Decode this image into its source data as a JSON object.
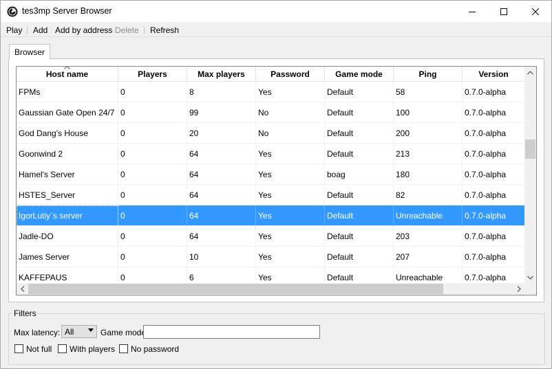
{
  "window": {
    "title": "tes3mp Server Browser"
  },
  "menu": {
    "play": "Play",
    "add": "Add",
    "add_by_address": "Add by address",
    "delete": "Delete",
    "refresh": "Refresh"
  },
  "tabs": [
    {
      "label": "Browser"
    }
  ],
  "table": {
    "columns": [
      "Host name",
      "Players",
      "Max players",
      "Password",
      "Game mode",
      "Ping",
      "Version"
    ],
    "rows": [
      [
        "FPMs",
        "0",
        "8",
        "Yes",
        "Default",
        "58",
        "0.7.0-alpha"
      ],
      [
        "Gaussian Gate Open 24/7",
        "0",
        "99",
        "No",
        "Default",
        "100",
        "0.7.0-alpha"
      ],
      [
        "God Dang's House",
        "0",
        "20",
        "No",
        "Default",
        "200",
        "0.7.0-alpha"
      ],
      [
        "Goonwind 2",
        "0",
        "64",
        "Yes",
        "Default",
        "213",
        "0.7.0-alpha"
      ],
      [
        "Hamel's Server",
        "0",
        "64",
        "Yes",
        "boag",
        "180",
        "0.7.0-alpha"
      ],
      [
        "HSTES_Server",
        "0",
        "64",
        "Yes",
        "Default",
        "82",
        "0.7.0-alpha"
      ],
      [
        "IgorLutiy`s server",
        "0",
        "64",
        "Yes",
        "Default",
        "Unreachable",
        "0.7.0-alpha"
      ],
      [
        "Jadle-DO",
        "0",
        "64",
        "Yes",
        "Default",
        "203",
        "0.7.0-alpha"
      ],
      [
        "James Server",
        "0",
        "10",
        "Yes",
        "Default",
        "207",
        "0.7.0-alpha"
      ],
      [
        "KAFFEPAUS",
        "0",
        "6",
        "Yes",
        "Default",
        "Unreachable",
        "0.7.0-alpha"
      ]
    ],
    "selected_row": 6
  },
  "filters": {
    "title": "Filters",
    "max_latency_label": "Max latency:",
    "max_latency_value": "All",
    "game_mode_label": "Game mode",
    "game_mode_value": "",
    "not_full_label": "Not full",
    "with_players_label": "With players",
    "no_password_label": "No password"
  },
  "colors": {
    "selection": "#3399ff",
    "window_bg": "#f0f0f0"
  }
}
